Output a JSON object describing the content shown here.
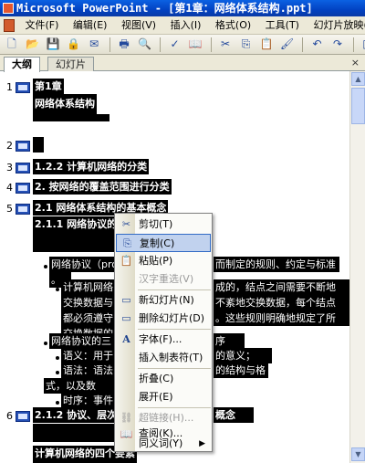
{
  "window": {
    "title": "Microsoft PowerPoint - [第1章：网络体系结构.ppt]"
  },
  "menubar": {
    "items": [
      "文件(F)",
      "编辑(E)",
      "视图(V)",
      "插入(I)",
      "格式(O)",
      "工具(T)",
      "幻灯片放映(D)"
    ]
  },
  "toolbar": {
    "icons": [
      "new-icon",
      "open-icon",
      "save-icon",
      "permission-icon",
      "email-icon",
      "print-icon",
      "preview-icon",
      "spelling-icon",
      "research-icon",
      "cut-icon",
      "copy-icon",
      "paste-icon",
      "format-painter-icon",
      "undo-icon",
      "redo-icon",
      "chart-icon",
      "table-icon",
      "tables-borders-icon"
    ]
  },
  "tabs": {
    "outline": "大纲",
    "slides": "幻灯片",
    "close": "×"
  },
  "outline": {
    "slide1_num": "1",
    "slide1_title": "第1章",
    "slide1_subtitle": "网络体系结构",
    "slide2_num": "2",
    "slide3_num": "3",
    "slide3_title": "1.2.2 计算机网络的分类",
    "slide4_num": "4",
    "slide4_title": "2. 按网络的覆盖范围进行分类",
    "slide5_num": "5",
    "slide5_title": "2.1  网络体系结构的基本概念",
    "slide5_sub1": "2.1.1  网络协议的",
    "b1_left": "网络协议（prot",
    "b1_right": "而制定的规则、约定与标准",
    "b1_end": "。",
    "b2_line1_left": "计算机网络",
    "b2_line1_right": "成的，结点之间需要不断地",
    "b2_line2_left": "交换数据与",
    "b2_line2_right": "不紊地交换数据，每个结点",
    "b2_line3_left": "都必须遵守",
    "b2_line3_right": "。这些规则明确地规定了所",
    "b2_line4": "交换数据的",
    "b3_left": "网络协议的三",
    "b3_right": "序",
    "b4_left": "语义：用于",
    "b4_right": "的意义；",
    "b5_left": "语法：语法",
    "b5_right": "的结构与格",
    "b5_line2": "式，以及数",
    "b6_left": "时序：事件",
    "slide6_num": "6",
    "slide6_title_left": "2.1.2  协议、层次",
    "slide6_title_right": "概念",
    "bottom_text": "计算机网络的四个要素"
  },
  "context_menu": {
    "items": [
      {
        "label": "剪切(T)",
        "icon": "cut-icon",
        "state": "normal"
      },
      {
        "label": "复制(C)",
        "icon": "copy-icon",
        "state": "selected"
      },
      {
        "label": "粘贴(P)",
        "icon": "paste-icon",
        "state": "normal"
      },
      {
        "label": "汉字重选(V)",
        "icon": "",
        "state": "disabled"
      },
      {
        "label": "新幻灯片(N)",
        "icon": "new-slide-icon",
        "state": "normal"
      },
      {
        "label": "删除幻灯片(D)",
        "icon": "delete-slide-icon",
        "state": "normal"
      },
      {
        "label": "字体(F)...",
        "icon": "font-icon",
        "state": "normal"
      },
      {
        "label": "插入制表符(T)",
        "icon": "",
        "state": "normal"
      },
      {
        "label": "折叠(C)",
        "icon": "",
        "state": "normal"
      },
      {
        "label": "展开(E)",
        "icon": "",
        "state": "normal"
      },
      {
        "label": "超链接(H)...",
        "icon": "hyperlink-icon",
        "state": "disabled"
      },
      {
        "label": "查阅(K)...",
        "icon": "research-icon",
        "state": "normal"
      },
      {
        "label": "同义词(Y)",
        "icon": "",
        "state": "submenu"
      }
    ]
  }
}
